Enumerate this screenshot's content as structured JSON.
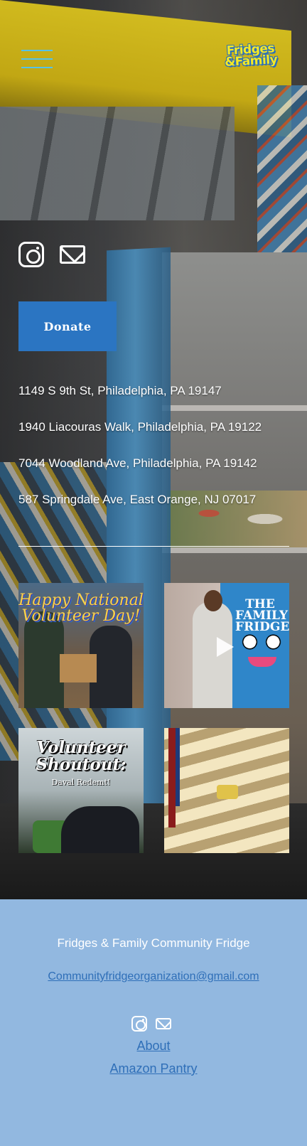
{
  "header": {
    "menu_icon": "hamburger-menu-icon",
    "logo_line1": "Fridges",
    "logo_line2": "&Family",
    "brand_yellow": "#f6ea24",
    "brand_blue": "#2d6fb8"
  },
  "hero": {
    "social_icons": [
      "instagram-icon",
      "mail-icon"
    ],
    "donate_label": "Donate",
    "donate_color": "#2b75c2",
    "addresses": [
      "1149 S 9th St, Philadelphia, PA 19147",
      "1940 Liacouras Walk, Philadelphia, PA 19122",
      "7044 Woodland Ave, Philadelphia, PA 19142",
      "587 Springdale Ave, East Orange, NJ 07017"
    ],
    "posts": [
      {
        "caption": "Happy National Volunteer Day!"
      },
      {
        "caption": "THE FAMILY FRIDGE"
      },
      {
        "caption": "Volunteer Shoutout:",
        "subcaption": "Daval Redemt!"
      },
      {
        "caption": ""
      }
    ]
  },
  "footer": {
    "title": "Fridges & Family Community Fridge",
    "email": "Communityfridgeorganization@gmail.com",
    "social_icons": [
      "instagram-icon",
      "mail-icon"
    ],
    "links": [
      "About",
      "Amazon Pantry"
    ],
    "background_color": "#92b8e0",
    "link_color": "#2f6fb8"
  }
}
